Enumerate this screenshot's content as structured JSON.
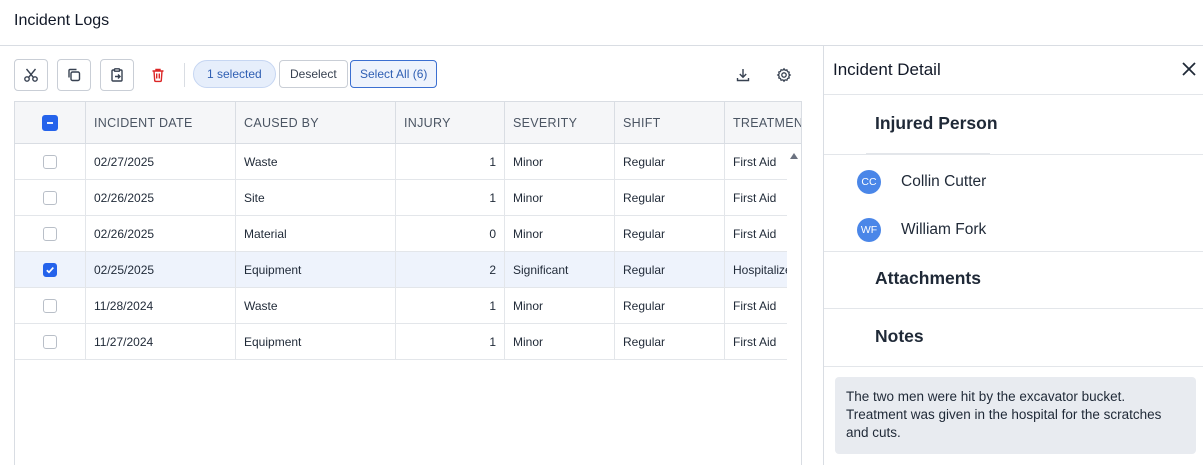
{
  "page": {
    "title": "Incident Logs"
  },
  "toolbar": {
    "selected_label": "1 selected",
    "deselect_label": "Deselect",
    "select_all_label": "Select All (6)"
  },
  "table": {
    "columns": [
      "INCIDENT DATE",
      "CAUSED BY",
      "INJURY",
      "SEVERITY",
      "SHIFT",
      "TREATMEN"
    ],
    "rows": [
      {
        "date": "02/27/2025",
        "caused_by": "Waste",
        "injury": "1",
        "severity": "Minor",
        "shift": "Regular",
        "treatment": "First Aid",
        "selected": false
      },
      {
        "date": "02/26/2025",
        "caused_by": "Site",
        "injury": "1",
        "severity": "Minor",
        "shift": "Regular",
        "treatment": "First Aid",
        "selected": false
      },
      {
        "date": "02/26/2025",
        "caused_by": "Material",
        "injury": "0",
        "severity": "Minor",
        "shift": "Regular",
        "treatment": "First Aid",
        "selected": false
      },
      {
        "date": "02/25/2025",
        "caused_by": "Equipment",
        "injury": "2",
        "severity": "Significant",
        "shift": "Regular",
        "treatment": "Hospitalize",
        "selected": true
      },
      {
        "date": "11/28/2024",
        "caused_by": "Waste",
        "injury": "1",
        "severity": "Minor",
        "shift": "Regular",
        "treatment": "First Aid",
        "selected": false
      },
      {
        "date": "11/27/2024",
        "caused_by": "Equipment",
        "injury": "1",
        "severity": "Minor",
        "shift": "Regular",
        "treatment": "First Aid",
        "selected": false
      }
    ]
  },
  "detail": {
    "title": "Incident Detail",
    "injured_title": "Injured Person",
    "people": [
      {
        "initials": "CC",
        "name": "Collin Cutter"
      },
      {
        "initials": "WF",
        "name": "William Fork"
      }
    ],
    "attachments_title": "Attachments",
    "notes_title": "Notes",
    "notes_text": "The two men were hit by the excavator bucket. Treatment was given in the hospital for the scratches and cuts."
  },
  "colors": {
    "accent": "#2563eb",
    "avatar": "#4a86e8",
    "delete": "#dc2626"
  },
  "icons": [
    "scissors-icon",
    "copy-icon",
    "export-icon",
    "trash-icon",
    "download-icon",
    "gear-icon",
    "close-icon",
    "sort-up-icon"
  ]
}
